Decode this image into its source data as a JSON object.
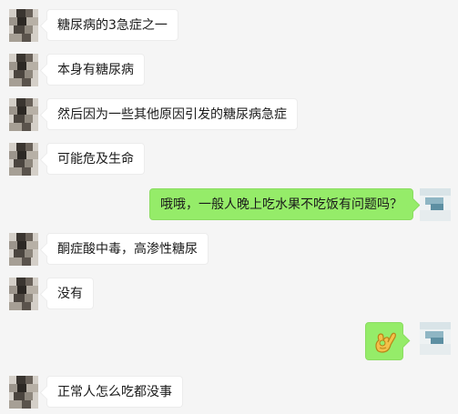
{
  "chat": {
    "messages": [
      {
        "side": "left",
        "text": "糖尿病的3急症之一"
      },
      {
        "side": "left",
        "text": "本身有糖尿病"
      },
      {
        "side": "left",
        "text": "然后因为一些其他原因引发的糖尿病急症"
      },
      {
        "side": "left",
        "text": "可能危及生命"
      },
      {
        "side": "right",
        "text": "哦哦，一般人晚上吃水果不吃饭有问题吗？"
      },
      {
        "side": "left",
        "text": "酮症酸中毒，高渗性糖尿"
      },
      {
        "side": "left",
        "text": "没有"
      },
      {
        "side": "right",
        "emoji": "ok-hand"
      },
      {
        "side": "left",
        "text": "正常人怎么吃都没事"
      }
    ]
  },
  "colors": {
    "background": "#f5f5f5",
    "sent_bubble": "#95ec69",
    "received_bubble": "#ffffff"
  }
}
